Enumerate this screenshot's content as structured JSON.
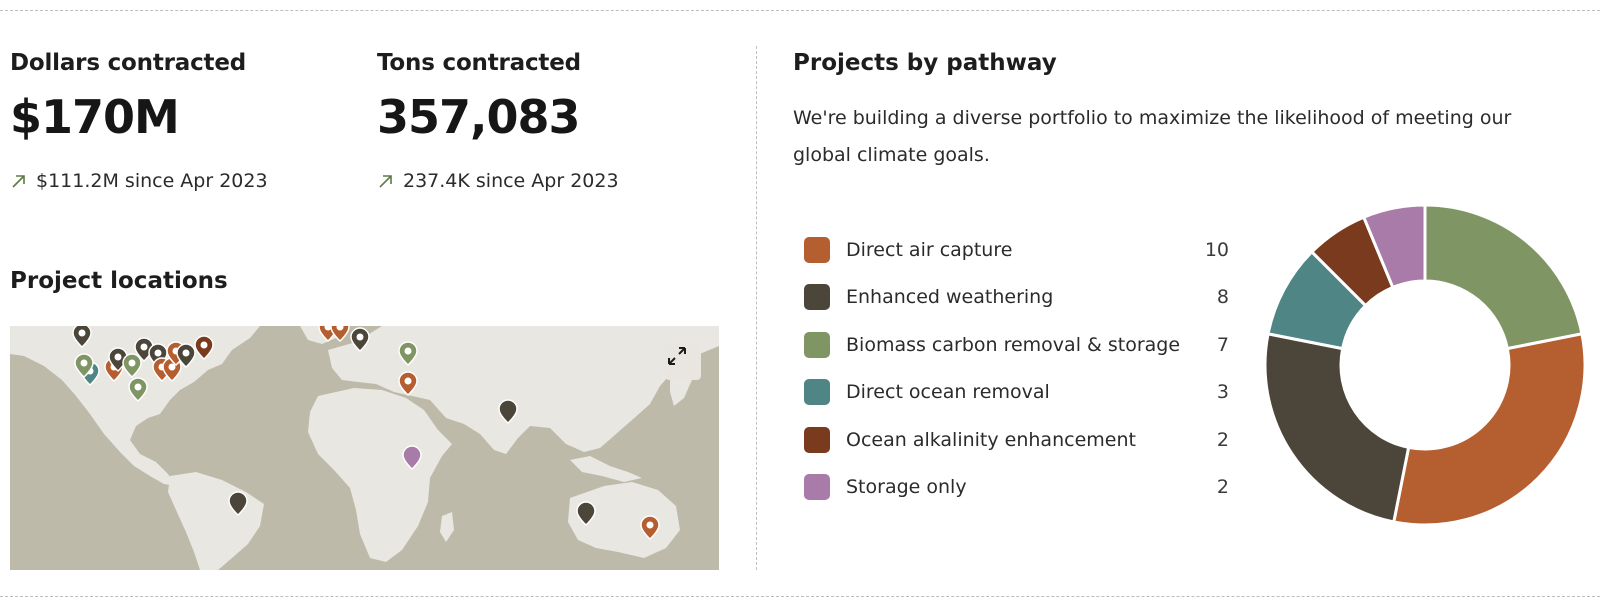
{
  "stats": {
    "dollars": {
      "label": "Dollars contracted",
      "value": "$170M",
      "delta": "$111.2M since Apr 2023"
    },
    "tons": {
      "label": "Tons contracted",
      "value": "357,083",
      "delta": "237.4K since Apr 2023"
    }
  },
  "locations": {
    "title": "Project locations",
    "expand_icon": "expand-arrows-icon"
  },
  "pathway": {
    "title": "Projects by pathway",
    "description": "We're building a diverse portfolio to maximize the likelihood of meeting our global climate goals.",
    "items": [
      {
        "label": "Direct air capture",
        "count": "10",
        "color": "#b55e2f"
      },
      {
        "label": "Enhanced weathering",
        "count": "8",
        "color": "#4c453a"
      },
      {
        "label": "Biomass carbon removal & storage",
        "count": "7",
        "color": "#7f9564"
      },
      {
        "label": "Direct ocean removal",
        "count": "3",
        "color": "#4f8685"
      },
      {
        "label": "Ocean alkalinity enhancement",
        "count": "2",
        "color": "#7a3a1d"
      },
      {
        "label": "Storage only",
        "count": "2",
        "color": "#a87ba9"
      }
    ]
  },
  "chart_data": {
    "type": "pie",
    "categories": [
      "Direct air capture",
      "Enhanced weathering",
      "Biomass carbon removal & storage",
      "Direct ocean removal",
      "Ocean alkalinity enhancement",
      "Storage only"
    ],
    "values": [
      10,
      8,
      7,
      3,
      2,
      2
    ],
    "colors": [
      "#b55e2f",
      "#4c453a",
      "#7f9564",
      "#4f8685",
      "#7a3a1d",
      "#a87ba9"
    ],
    "donut": true
  },
  "colors": {
    "accent_arrow": "#5d7a45",
    "map_ocean": "#bdbaaa",
    "map_land": "#e9e7e2"
  }
}
